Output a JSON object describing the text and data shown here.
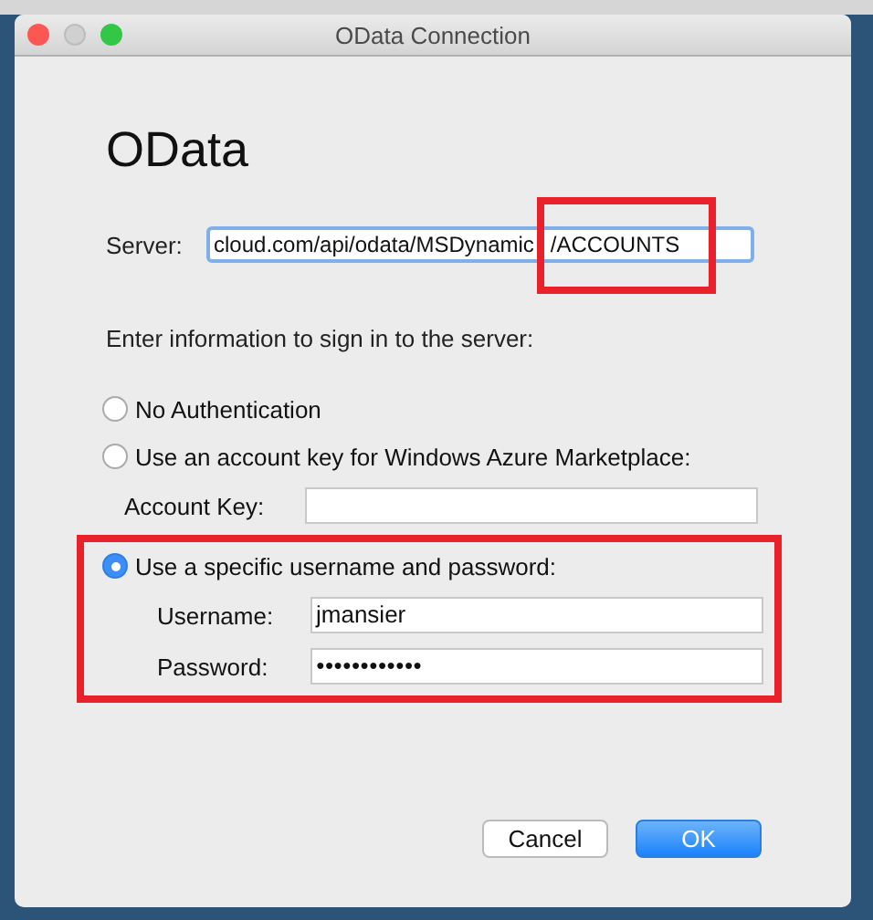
{
  "window": {
    "title": "OData Connection"
  },
  "heading": "OData",
  "server": {
    "label": "Server:",
    "value": "cloud.com/api/odata/MSDynamic",
    "highlighted_text": "/ACCOUNTS",
    "highlighted": true
  },
  "instruction": "Enter information to sign in to the server:",
  "options": [
    {
      "label": "No Authentication",
      "selected": false,
      "highlighted": false
    },
    {
      "label": "Use an account key for Windows Azure Marketplace:",
      "selected": false,
      "highlighted": false,
      "fields": [
        {
          "label": "Account Key:",
          "kind": "text"
        }
      ]
    },
    {
      "label": "Use a specific username and password:",
      "selected": true,
      "highlighted": true,
      "fields": [
        {
          "label": "Username:",
          "kind": "text",
          "value": "jmansier"
        },
        {
          "label": "Password:",
          "kind": "password",
          "value": "●●●●●●●●●●●●"
        }
      ]
    }
  ],
  "buttons": [
    {
      "label": "Cancel",
      "kind": "secondary"
    },
    {
      "label": "OK",
      "kind": "default"
    }
  ]
}
